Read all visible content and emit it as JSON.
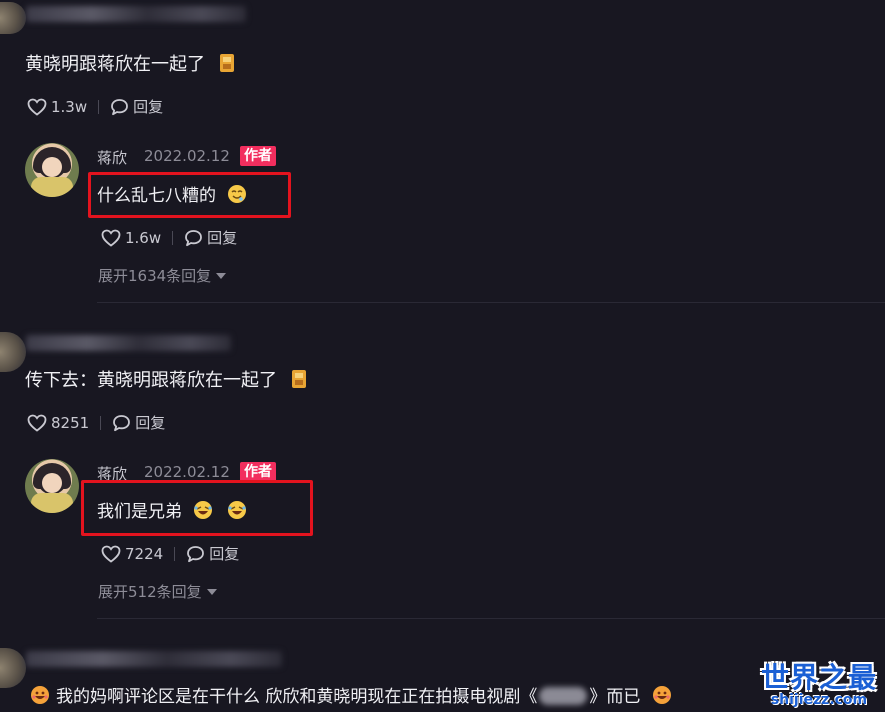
{
  "comments": [
    {
      "text": "黄晓明跟蒋欣在一起了",
      "likes": "1.3w",
      "reply_label": "回复",
      "author_reply": {
        "name": "蒋欣",
        "date": "2022.02.12",
        "badge": "作者",
        "text": "什么乱七八糟的",
        "likes": "1.6w",
        "reply_label": "回复",
        "expand": "展开1634条回复"
      }
    },
    {
      "text": "传下去：黄晓明跟蒋欣在一起了",
      "likes": "8251",
      "reply_label": "回复",
      "author_reply": {
        "name": "蒋欣",
        "date": "2022.02.12",
        "badge": "作者",
        "text": "我们是兄弟",
        "likes": "7224",
        "reply_label": "回复",
        "expand": "展开512条回复"
      }
    },
    {
      "text_before": "我的妈啊评论区是在干什么 欣欣和黄晓明现在正在拍摄电视剧《",
      "text_after": "》而已"
    }
  ],
  "watermark": {
    "main": "世界之最",
    "sub": "shijiezz.com"
  },
  "colors": {
    "background": "#181721",
    "badge": "#f22e5e",
    "highlight": "#e3131e"
  }
}
